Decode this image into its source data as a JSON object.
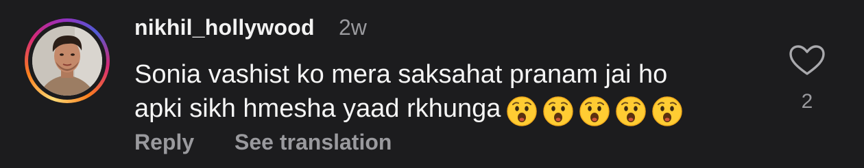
{
  "comment": {
    "username": "nikhil_hollywood",
    "timestamp": "2w",
    "text_line1": "Sonia vashist ko mera saksahat pranam jai ho",
    "text_line2": "apki sikh hmesha yaad rkhunga",
    "emojis": [
      "hushed-face",
      "hushed-face",
      "hushed-face",
      "hushed-face",
      "hushed-face"
    ],
    "like_count": "2"
  },
  "actions": {
    "reply_label": "Reply",
    "translate_label": "See translation"
  },
  "colors": {
    "background": "#1c1c1e",
    "primary_text": "#f5f5f5",
    "secondary_text": "#9a9a9e",
    "story_ring_start": "#feda75",
    "story_ring_end": "#d62976"
  }
}
